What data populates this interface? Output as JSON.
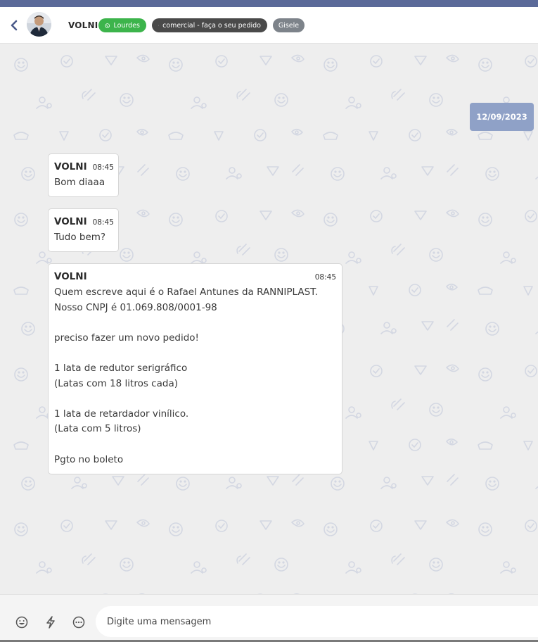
{
  "header": {
    "contact_name": "VOLNI",
    "connection_label": "Lourdes",
    "queue_label": "comercial - faça o seu pedido",
    "agent_label": "Gisele"
  },
  "chat": {
    "date_label": "12/09/2023",
    "messages": [
      {
        "sender": "VOLNI",
        "time": "08:45",
        "text": "Bom diaaa"
      },
      {
        "sender": "VOLNI",
        "time": "08:45",
        "text": "Tudo bem?"
      },
      {
        "sender": "VOLNI",
        "time": "08:45",
        "text": "Quem escreve aqui é o Rafael Antunes da RANNIPLAST.\nNosso CNPJ é 01.069.808/0001-98\n\npreciso fazer um novo pedido!\n\n1 lata de redutor serigráfico\n(Latas com 18 litros cada)\n\n1 lata de retardador vinílico.\n(Lata com 5 litros)\n\nPgto no boleto"
      }
    ]
  },
  "composer": {
    "placeholder": "Digite uma mensagem"
  },
  "icons": {
    "back": "chevron-left-icon",
    "whatsapp": "whatsapp-icon",
    "queue": "sitemap-icon",
    "emoji": "emoji-icon",
    "quick_reply": "lightning-icon",
    "more": "more-icon"
  },
  "colors": {
    "top_strip": "#5b6a99",
    "connection_badge": "#3cb44b",
    "queue_badge": "#4a4a4a",
    "agent_badge": "#7d838a",
    "date_chip": "#8fa1c7",
    "chat_background": "#eeeeee"
  }
}
